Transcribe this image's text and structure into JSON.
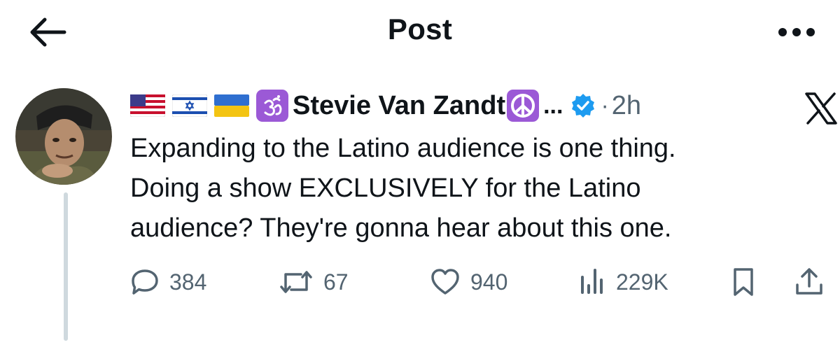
{
  "header": {
    "title": "Post",
    "back_icon": "arrow-left-icon",
    "more_icon": "more-horizontal-icon"
  },
  "post": {
    "flags": [
      "us-flag-icon",
      "israel-flag-icon",
      "ukraine-flag-icon"
    ],
    "prefix_emoji": "om-emoji-icon",
    "author_name": "Stevie Van Zandt",
    "suffix_emoji": "peace-emoji-icon",
    "ellipsis": "...",
    "verified_icon": "verified-badge-icon",
    "separator": "·",
    "timestamp": "2h",
    "platform_icon": "x-logo-icon",
    "text_lines": [
      "Expanding to the Latino audience is one thing.",
      "Doing a show EXCLUSIVELY for the Latino",
      "audience? They're gonna hear about this one."
    ]
  },
  "actions": {
    "reply": {
      "icon": "reply-icon",
      "count": "384"
    },
    "repost": {
      "icon": "repost-icon",
      "count": "67"
    },
    "like": {
      "icon": "heart-icon",
      "count": "940"
    },
    "views": {
      "icon": "views-chart-icon",
      "count": "229K"
    },
    "bookmark": {
      "icon": "bookmark-icon"
    },
    "share": {
      "icon": "share-icon"
    }
  },
  "colors": {
    "text": "#0f1419",
    "secondary": "#536471",
    "verified": "#1d9bf0",
    "emoji_purple": "#9b59d6",
    "thread_line": "#cfd9de"
  }
}
